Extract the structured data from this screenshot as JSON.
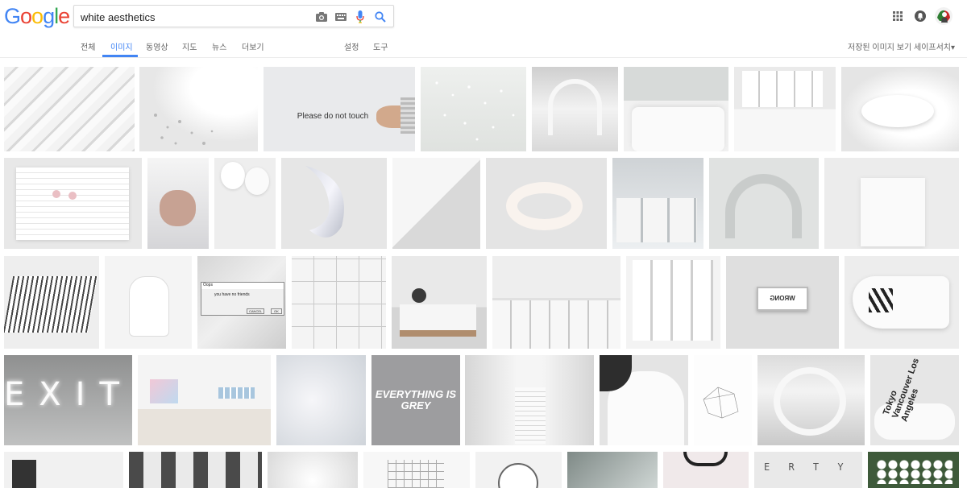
{
  "logo": {
    "text": "Google"
  },
  "search": {
    "value": "white aesthetics"
  },
  "tabs": [
    {
      "label": "전체",
      "active": false
    },
    {
      "label": "이미지",
      "active": true
    },
    {
      "label": "동영상",
      "active": false
    },
    {
      "label": "지도",
      "active": false
    },
    {
      "label": "뉴스",
      "active": false
    },
    {
      "label": "더보기",
      "active": false
    },
    {
      "label": "설정",
      "active": false
    },
    {
      "label": "도구",
      "active": false
    }
  ],
  "right_links": {
    "saved": "저장된 이미지 보기",
    "safesearch": "세이프서치▾"
  },
  "thumb_text": {
    "touch": "Please do not touch",
    "exit": "EXIT",
    "grey": "EVERYTHING IS GREY",
    "wrong": "WRONG",
    "dialog_title": "Oops",
    "dialog_msg": "you have no friends",
    "dialog_cancel": "CANCEL",
    "dialog_ok": "OK",
    "tokyo": "Tokyo Vancouver Los Angeles",
    "keys": "E R T Y"
  },
  "colors": {
    "blue": "#4285f4",
    "red": "#ea4335",
    "yellow": "#fbbc05",
    "green": "#34a853"
  }
}
